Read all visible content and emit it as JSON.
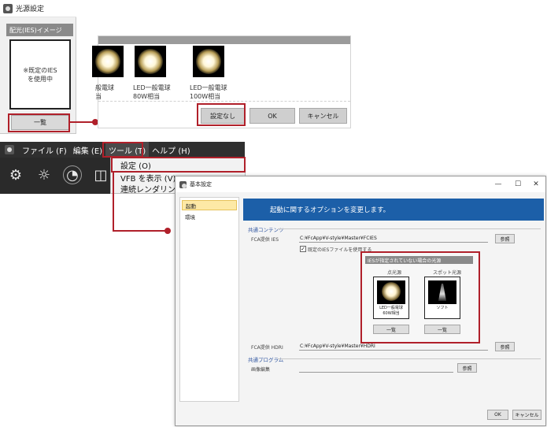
{
  "light_window": {
    "title": "光源設定",
    "ies_group_label": "配光(IES)イメージ",
    "preview_text_line1": "※既定のIES",
    "preview_text_line2": "を使用中",
    "list_button": "一覧"
  },
  "light_strip": {
    "bulbs": [
      {
        "line1": "般電球",
        "line2": "当"
      },
      {
        "line1": "LED一般電球",
        "line2": "80W相当"
      },
      {
        "line1": "LED一般電球",
        "line2": "100W相当"
      }
    ],
    "none_button": "設定なし",
    "ok_button": "OK",
    "cancel_button": "キャンセル"
  },
  "menubar": {
    "items": [
      "ファイル (F)",
      "編集 (E)",
      "ツール (T)",
      "ヘルプ (H)"
    ],
    "tools_menu": [
      "設定 (O)",
      "VFB を表示 (V)",
      "連続レンダリング"
    ]
  },
  "settings_dialog": {
    "title": "基本設定",
    "window_controls": [
      "—",
      "☐",
      "✕"
    ],
    "sidebar": [
      "起動",
      "環境"
    ],
    "banner": "起動に関するオプションを変更します。",
    "sections": {
      "shared_contents": "共通コンテンツ",
      "shared_programs": "共通プログラム"
    },
    "ies_row": {
      "label": "FCA提供 IES",
      "path": "C:¥FcApp¥V-style¥Master¥FCIES",
      "button": "参照"
    },
    "ies_checkbox": {
      "label": "既定のIESファイルを使用する",
      "checked": true
    },
    "default_panel": {
      "header": "IESが指定されていない場合の光源",
      "columns": [
        {
          "label": "点光源",
          "caption1": "LED一般電球",
          "caption2": "60W相当",
          "button": "一覧"
        },
        {
          "label": "スポット光源",
          "caption1": "ソフト",
          "caption2": "",
          "button": "一覧"
        }
      ]
    },
    "hdri_row": {
      "label": "FCA提供 HDRI",
      "path": "C:¥FcApp¥V-style¥Master¥HDRI",
      "button": "参照"
    },
    "image_editor_row": {
      "label": "画像編集",
      "path": "",
      "button": "参照"
    },
    "ok_button": "OK",
    "cancel_button": "キャンセル"
  },
  "colors": {
    "callout_red": "#b0202a",
    "banner_blue": "#1c5fa8",
    "menubar_dark": "#2f2f2f",
    "selected_yellow": "#fde9a6"
  },
  "icons": [
    "gear-icon",
    "weather-icon",
    "light-bulb-icon",
    "camera-icon"
  ]
}
